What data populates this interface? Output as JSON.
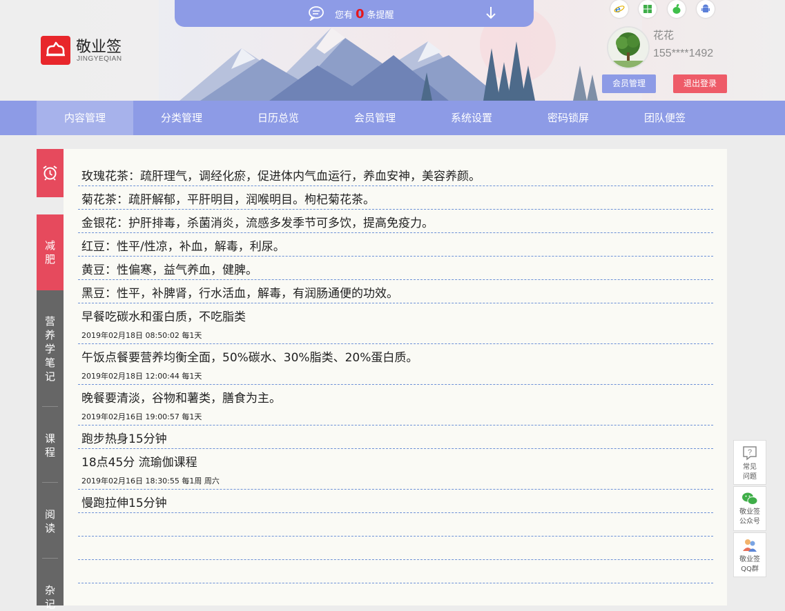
{
  "notice": {
    "prefix": "您有",
    "count": "0",
    "suffix": "条提醒"
  },
  "logo": {
    "name": "敬业签",
    "subtitle": "JINGYEQIAN"
  },
  "platform_icons": [
    "ie-icon",
    "windows-icon",
    "apple-icon",
    "android-icon"
  ],
  "user": {
    "name": "花花",
    "phone": "155****1492"
  },
  "buttons": {
    "member": "会员管理",
    "logout": "退出登录"
  },
  "nav": {
    "items": [
      {
        "label": "内容管理",
        "active": true
      },
      {
        "label": "分类管理"
      },
      {
        "label": "日历总览"
      },
      {
        "label": "会员管理"
      },
      {
        "label": "系统设置"
      },
      {
        "label": "密码锁屏"
      },
      {
        "label": "团队便签"
      }
    ]
  },
  "sidebar": {
    "tabs": [
      {
        "label": "减\n肥",
        "active": true
      },
      {
        "label": "营\n养\n学\n笔\n记"
      },
      {
        "label": "课\n程"
      },
      {
        "label": "阅\n读"
      },
      {
        "label": "杂\n记"
      }
    ]
  },
  "notes": [
    {
      "text": "玫瑰花茶：疏肝理气，调经化瘀，促进体内气血运行，养血安神，美容养颜。"
    },
    {
      "text": "菊花茶：疏肝解郁，平肝明目，润喉明目。枸杞菊花茶。"
    },
    {
      "text": "金银花：护肝排毒，杀菌消炎，流感多发季节可多饮，提高免疫力。"
    },
    {
      "text": "红豆：性平/性凉，补血，解毒，利尿。"
    },
    {
      "text": "黄豆：性偏寒，益气养血，健脾。"
    },
    {
      "text": "黑豆：性平，补脾肾，行水活血，解毒，有润肠通便的功效。"
    },
    {
      "text": "早餐吃碳水和蛋白质，不吃脂类",
      "meta": "2019年02月18日 08:50:02 每1天"
    },
    {
      "text": "午饭点餐要营养均衡全面，50%碳水、30%脂类、20%蛋白质。",
      "meta": "2019年02月18日 12:00:44 每1天"
    },
    {
      "text": "晚餐要清淡，谷物和薯类，膳食为主。",
      "meta": "2019年02月16日 19:00:57 每1天"
    },
    {
      "text": "跑步热身15分钟"
    },
    {
      "text": "18点45分 流瑜伽课程",
      "meta": "2019年02月16日 18:30:55 每1周 周六"
    },
    {
      "text": "慢跑拉伸15分钟"
    },
    {
      "text": ""
    },
    {
      "text": ""
    },
    {
      "text": ""
    }
  ],
  "float_buttons": [
    {
      "icon": "help-icon",
      "label": "常见\n问题"
    },
    {
      "icon": "wechat-icon",
      "label": "敬业签\n公众号"
    },
    {
      "icon": "qq-icon",
      "label": "敬业签\nQQ群"
    }
  ],
  "colors": {
    "accent": "#8d9be6",
    "accent_light": "#a7b2eb",
    "red": "#e64a5d",
    "logout": "#ee5b68",
    "divider": "#6a8fd6",
    "sidebar": "#666666"
  }
}
